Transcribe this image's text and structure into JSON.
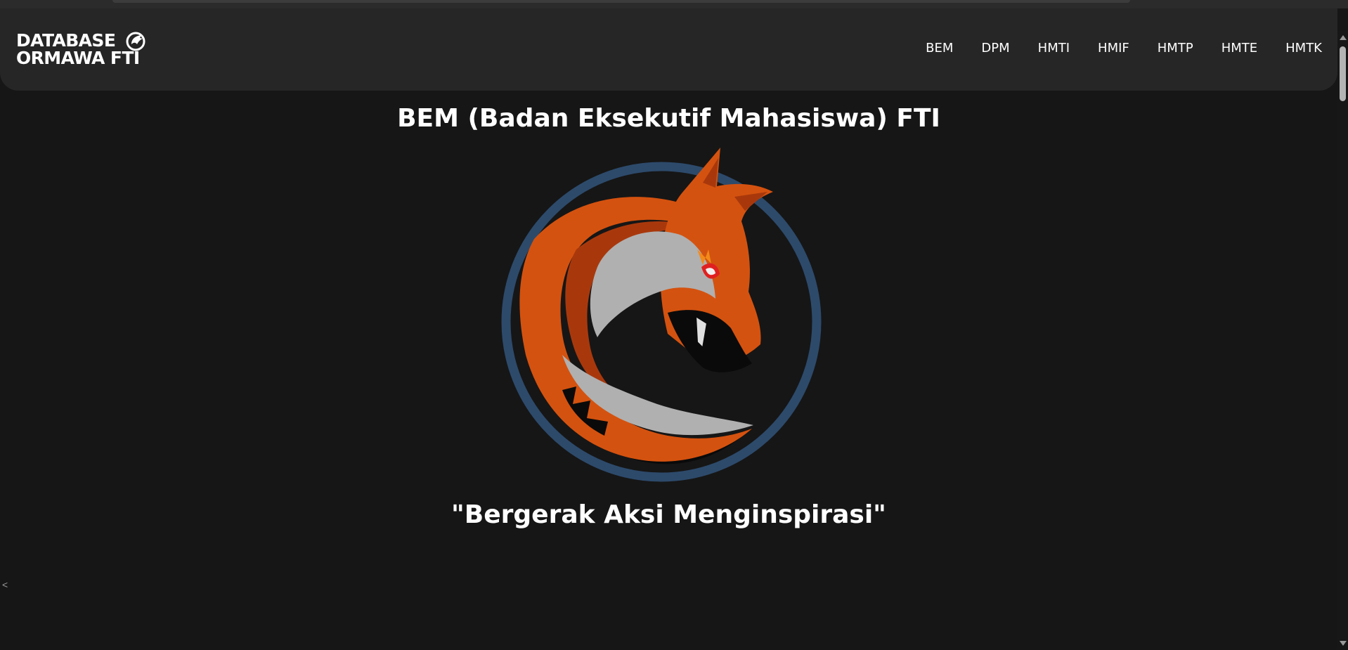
{
  "header": {
    "logo_line1": "DATABASE",
    "logo_line2": "ORMAWA FTI",
    "logo_icon": "fox-head-icon",
    "nav": [
      "BEM",
      "DPM",
      "HMTI",
      "HMIF",
      "HMTP",
      "HMTE",
      "HMTK"
    ]
  },
  "main": {
    "title": "BEM (Badan Eksekutif Mahasiswa) FTI",
    "emblem_icon": "fox-emblem-icon",
    "motto": "\"Bergerak Aksi Menginspirasi\"",
    "stray_text": "<"
  },
  "colors": {
    "background": "#161616",
    "navbar": "#262626",
    "ring": "#2d4a6b",
    "fox_orange": "#d4520f",
    "fox_gray": "#b0b0b0"
  }
}
